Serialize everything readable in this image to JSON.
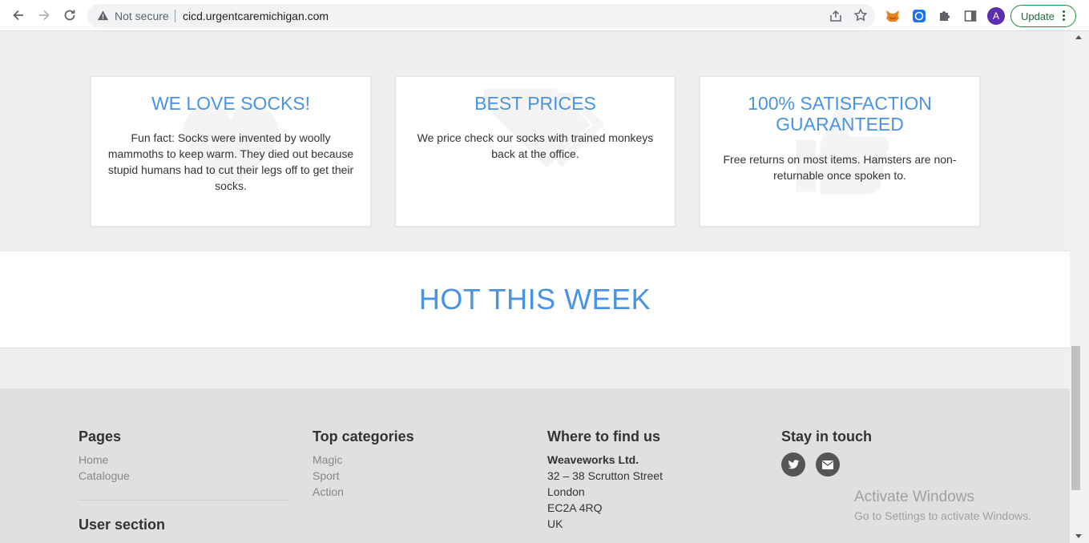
{
  "browser": {
    "security_label": "Not secure",
    "url": "cicd.urgentcaremichigan.com",
    "avatar_letter": "A",
    "update_label": "Update"
  },
  "features": [
    {
      "title": "WE LOVE SOCKS!",
      "text": "Fun fact: Socks were invented by woolly mammoths to keep warm. They died out because stupid humans had to cut their legs off to get their socks."
    },
    {
      "title": "BEST PRICES",
      "text": "We price check our socks with trained monkeys back at the office."
    },
    {
      "title": "100% SATISFACTION GUARANTEED",
      "text": "Free returns on most items. Hamsters are non-returnable once spoken to."
    }
  ],
  "hot": {
    "title": "HOT THIS WEEK"
  },
  "footer": {
    "pages": {
      "heading": "Pages",
      "links": [
        "Home",
        "Catalogue"
      ]
    },
    "user_section": {
      "heading": "User section"
    },
    "categories": {
      "heading": "Top categories",
      "links": [
        "Magic",
        "Sport",
        "Action"
      ]
    },
    "location": {
      "heading": "Where to find us",
      "company": "Weaveworks Ltd.",
      "address": [
        "32 – 38 Scrutton Street",
        "London",
        "EC2A 4RQ",
        "UK"
      ]
    },
    "social": {
      "heading": "Stay in touch",
      "icons": [
        "twitter-icon",
        "envelope-icon"
      ]
    }
  },
  "watermark": {
    "line1": "Activate Windows",
    "line2": "Go to Settings to activate Windows."
  },
  "colors": {
    "accent": "#4993e4",
    "footer_bg": "#e0e0e0",
    "page_bg": "#efefef"
  }
}
